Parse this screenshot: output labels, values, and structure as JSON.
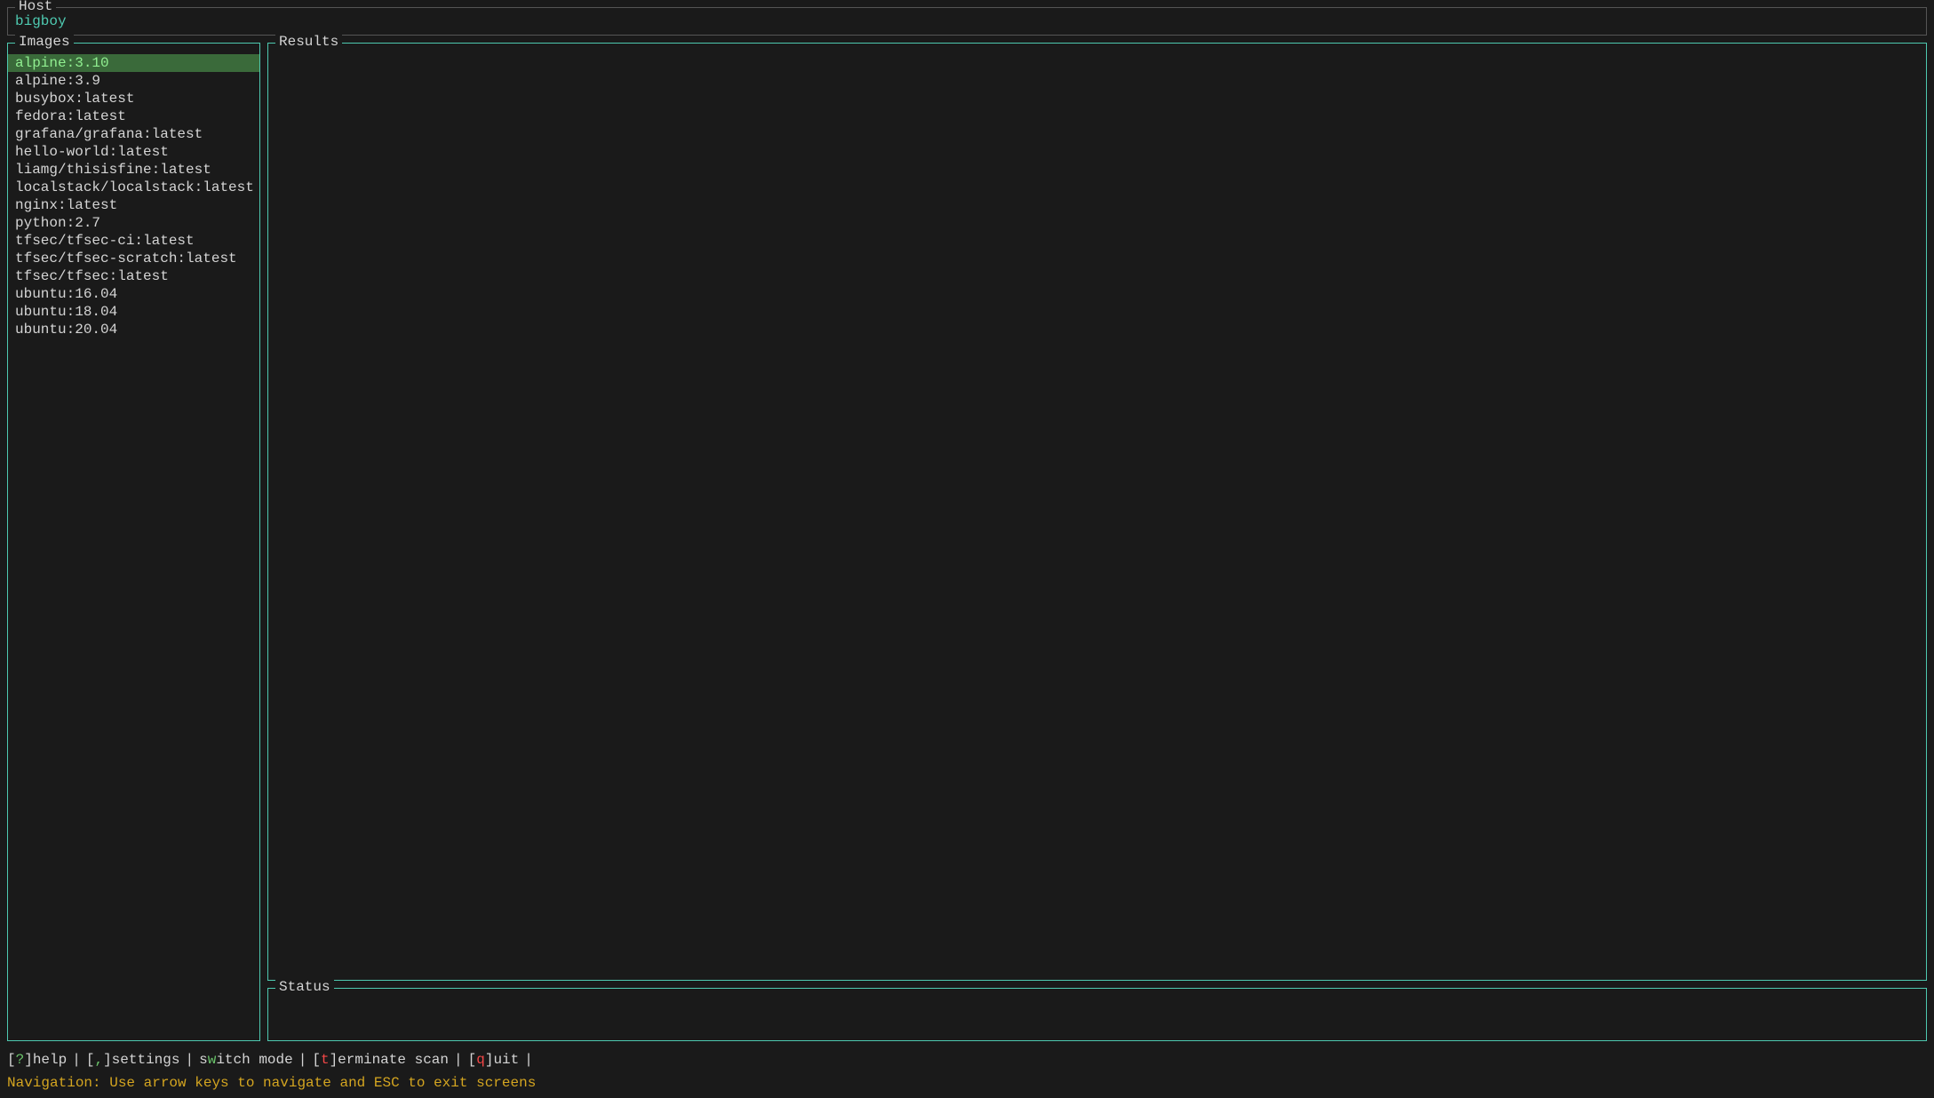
{
  "host": {
    "label": "Host",
    "value": "bigboy"
  },
  "images_panel": {
    "label": "Images",
    "items": [
      {
        "name": "alpine:3.10",
        "selected": true
      },
      {
        "name": "alpine:3.9",
        "selected": false
      },
      {
        "name": "busybox:latest",
        "selected": false
      },
      {
        "name": "fedora:latest",
        "selected": false
      },
      {
        "name": "grafana/grafana:latest",
        "selected": false
      },
      {
        "name": "hello-world:latest",
        "selected": false
      },
      {
        "name": "liamg/thisisfine:latest",
        "selected": false
      },
      {
        "name": "localstack/localstack:latest",
        "selected": false
      },
      {
        "name": "nginx:latest",
        "selected": false
      },
      {
        "name": "python:2.7",
        "selected": false
      },
      {
        "name": "tfsec/tfsec-ci:latest",
        "selected": false
      },
      {
        "name": "tfsec/tfsec-scratch:latest",
        "selected": false
      },
      {
        "name": "tfsec/tfsec:latest",
        "selected": false
      },
      {
        "name": "ubuntu:16.04",
        "selected": false
      },
      {
        "name": "ubuntu:18.04",
        "selected": false
      },
      {
        "name": "ubuntu:20.04",
        "selected": false
      }
    ]
  },
  "results_panel": {
    "label": "Results"
  },
  "status_panel": {
    "label": "Status"
  },
  "keybindings": {
    "help_bracket_open": "[",
    "help_key": "?",
    "help_bracket_close": "]",
    "help_label": " help",
    "sep1": " | ",
    "settings_bracket_open": "[",
    "settings_key": ",",
    "settings_bracket_close": "]",
    "settings_label": " settings",
    "sep2": " | ",
    "switch_prefix": " s",
    "switch_key": "w",
    "switch_suffix": "itch mode",
    "sep3": " | ",
    "terminate_prefix": " ",
    "terminate_bracket_open": "[",
    "terminate_key": "t",
    "terminate_bracket_close": "]",
    "terminate_label": "erminate scan",
    "sep4": " | ",
    "quit_bracket_open": "[",
    "quit_key": "q",
    "quit_bracket_close": "]",
    "quit_label": "uit",
    "sep5": " |"
  },
  "navigation": {
    "text": "Navigation: Use arrow keys to navigate and ESC to exit screens"
  }
}
